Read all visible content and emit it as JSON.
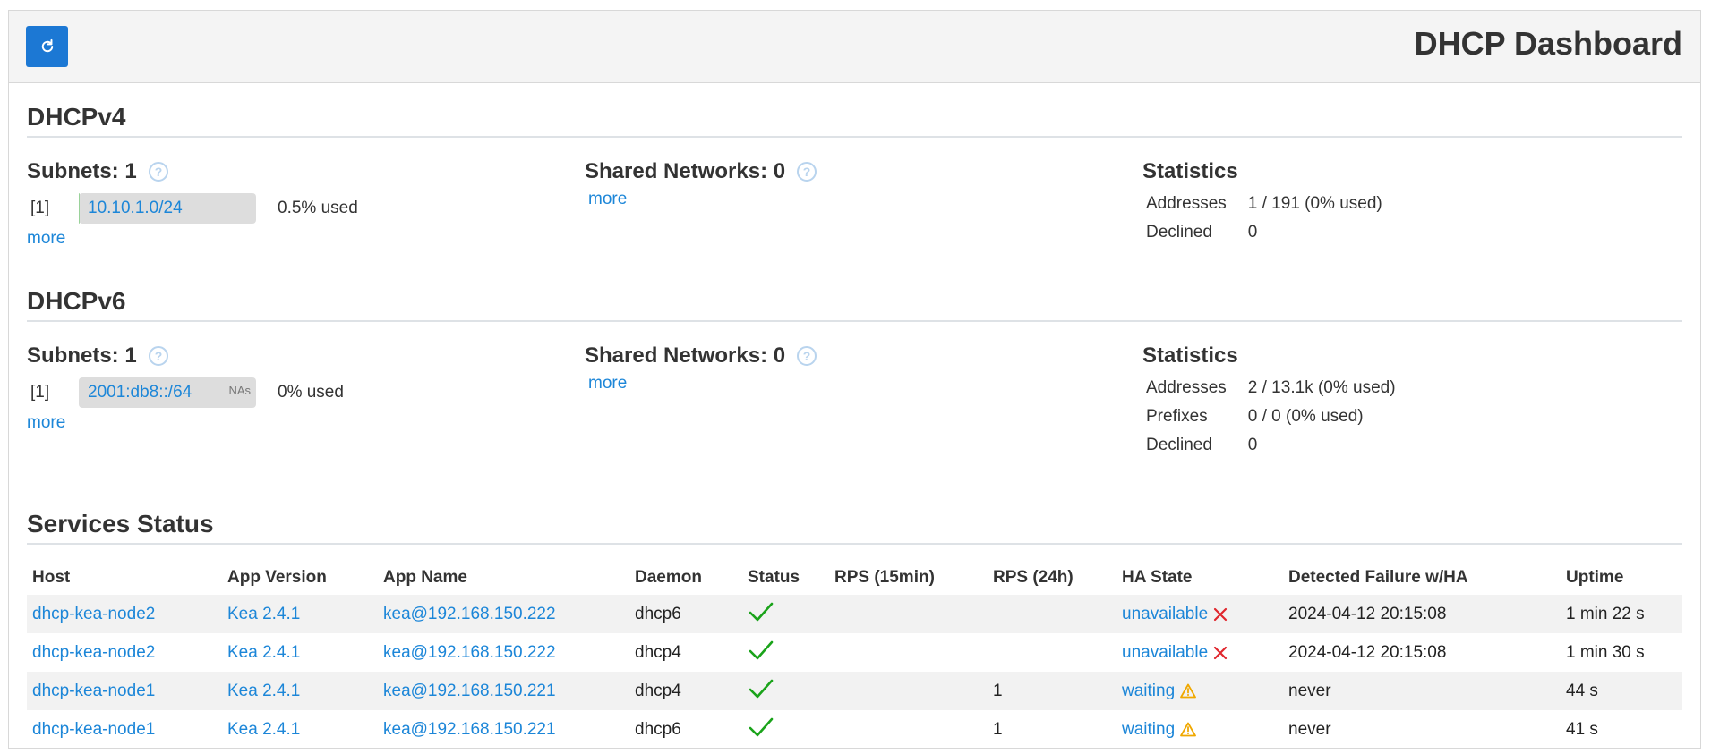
{
  "header": {
    "title": "DHCP Dashboard",
    "refresh_icon": "refresh-icon"
  },
  "dhcp4": {
    "title": "DHCPv4",
    "subnets_label": "Subnets: 1",
    "subnets": [
      {
        "index": "[1]",
        "name": "10.10.1.0/24",
        "used": "0.5% used",
        "fill_percent": 0.5
      }
    ],
    "subnets_more": "more",
    "shared_label": "Shared Networks: 0",
    "shared_more": "more",
    "stats_title": "Statistics",
    "stats": [
      {
        "key": "Addresses",
        "value": "1 / 191 (0% used)"
      },
      {
        "key": "Declined",
        "value": "0"
      }
    ]
  },
  "dhcp6": {
    "title": "DHCPv6",
    "subnets_label": "Subnets: 1",
    "subnets": [
      {
        "index": "[1]",
        "name": "2001:db8::/64",
        "badge": "NAs",
        "used": "0% used",
        "fill_percent": 0
      }
    ],
    "subnets_more": "more",
    "shared_label": "Shared Networks: 0",
    "shared_more": "more",
    "stats_title": "Statistics",
    "stats": [
      {
        "key": "Addresses",
        "value": "2 / 13.1k (0% used)"
      },
      {
        "key": "Prefixes",
        "value": "0 / 0 (0% used)"
      },
      {
        "key": "Declined",
        "value": "0"
      }
    ]
  },
  "services": {
    "title": "Services Status",
    "columns": [
      "Host",
      "App Version",
      "App Name",
      "Daemon",
      "Status",
      "RPS (15min)",
      "RPS (24h)",
      "HA State",
      "Detected Failure w/HA",
      "Uptime"
    ],
    "rows": [
      {
        "host": "dhcp-kea-node2",
        "version": "Kea 2.4.1",
        "app": "kea@192.168.150.222",
        "daemon": "dhcp6",
        "status": "ok",
        "rps15": "",
        "rps24": "",
        "ha_state": "unavailable",
        "ha_icon": "cross-icon",
        "failure": "2024-04-12 20:15:08",
        "uptime": "1 min 22 s"
      },
      {
        "host": "dhcp-kea-node2",
        "version": "Kea 2.4.1",
        "app": "kea@192.168.150.222",
        "daemon": "dhcp4",
        "status": "ok",
        "rps15": "",
        "rps24": "",
        "ha_state": "unavailable",
        "ha_icon": "cross-icon",
        "failure": "2024-04-12 20:15:08",
        "uptime": "1 min 30 s"
      },
      {
        "host": "dhcp-kea-node1",
        "version": "Kea 2.4.1",
        "app": "kea@192.168.150.221",
        "daemon": "dhcp4",
        "status": "ok",
        "rps15": "",
        "rps24": "1",
        "ha_state": "waiting",
        "ha_icon": "warning-icon",
        "failure": "never",
        "uptime": "44 s"
      },
      {
        "host": "dhcp-kea-node1",
        "version": "Kea 2.4.1",
        "app": "kea@192.168.150.221",
        "daemon": "dhcp6",
        "status": "ok",
        "rps15": "",
        "rps24": "1",
        "ha_state": "waiting",
        "ha_icon": "warning-icon",
        "failure": "never",
        "uptime": "41 s"
      }
    ]
  },
  "colors": {
    "primary": "#1c78d4",
    "link": "#1c86d8",
    "ok": "#1aa31a",
    "error": "#e0262d",
    "warning": "#f0a800"
  }
}
